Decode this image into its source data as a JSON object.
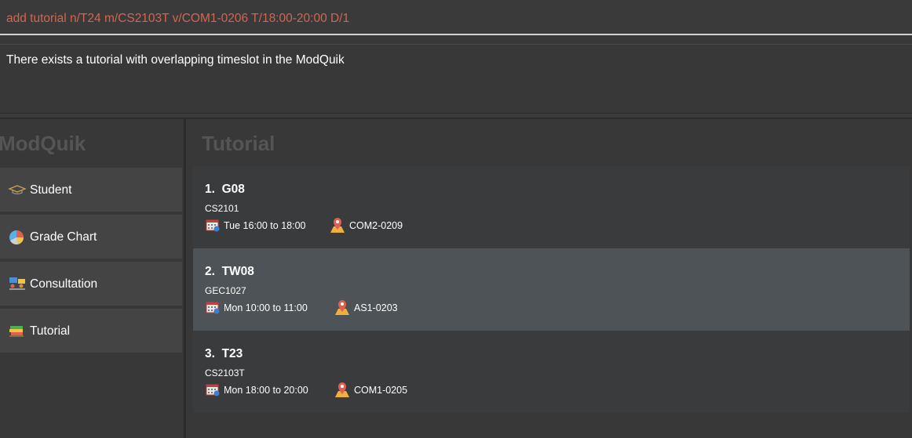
{
  "command": {
    "input_value": "add tutorial n/T24 m/CS2103T v/COM1-0206 T/18:00-20:00 D/1"
  },
  "result": {
    "message": "There exists a tutorial with overlapping timeslot in the ModQuik"
  },
  "sidebar": {
    "title": "ModQuik",
    "items": [
      {
        "label": "Student",
        "icon": "graduation-cap-icon"
      },
      {
        "label": "Grade Chart",
        "icon": "pie-chart-icon"
      },
      {
        "label": "Consultation",
        "icon": "consultation-icon"
      },
      {
        "label": "Tutorial",
        "icon": "books-icon"
      }
    ]
  },
  "main": {
    "title": "Tutorial",
    "tutorials": [
      {
        "index": "1.",
        "name": "G08",
        "module": "CS2101",
        "time": "Tue 16:00 to 18:00",
        "venue": "COM2-0209",
        "selected": false
      },
      {
        "index": "2.",
        "name": "TW08",
        "module": "GEC1027",
        "time": "Mon 10:00 to 11:00",
        "venue": "AS1-0203",
        "selected": true
      },
      {
        "index": "3.",
        "name": "T23",
        "module": "CS2103T",
        "time": "Mon 18:00 to 20:00",
        "venue": "COM1-0205",
        "selected": false
      }
    ]
  },
  "colors": {
    "command_text": "#d06651",
    "background": "#383838",
    "selected_card": "#4d5356"
  }
}
